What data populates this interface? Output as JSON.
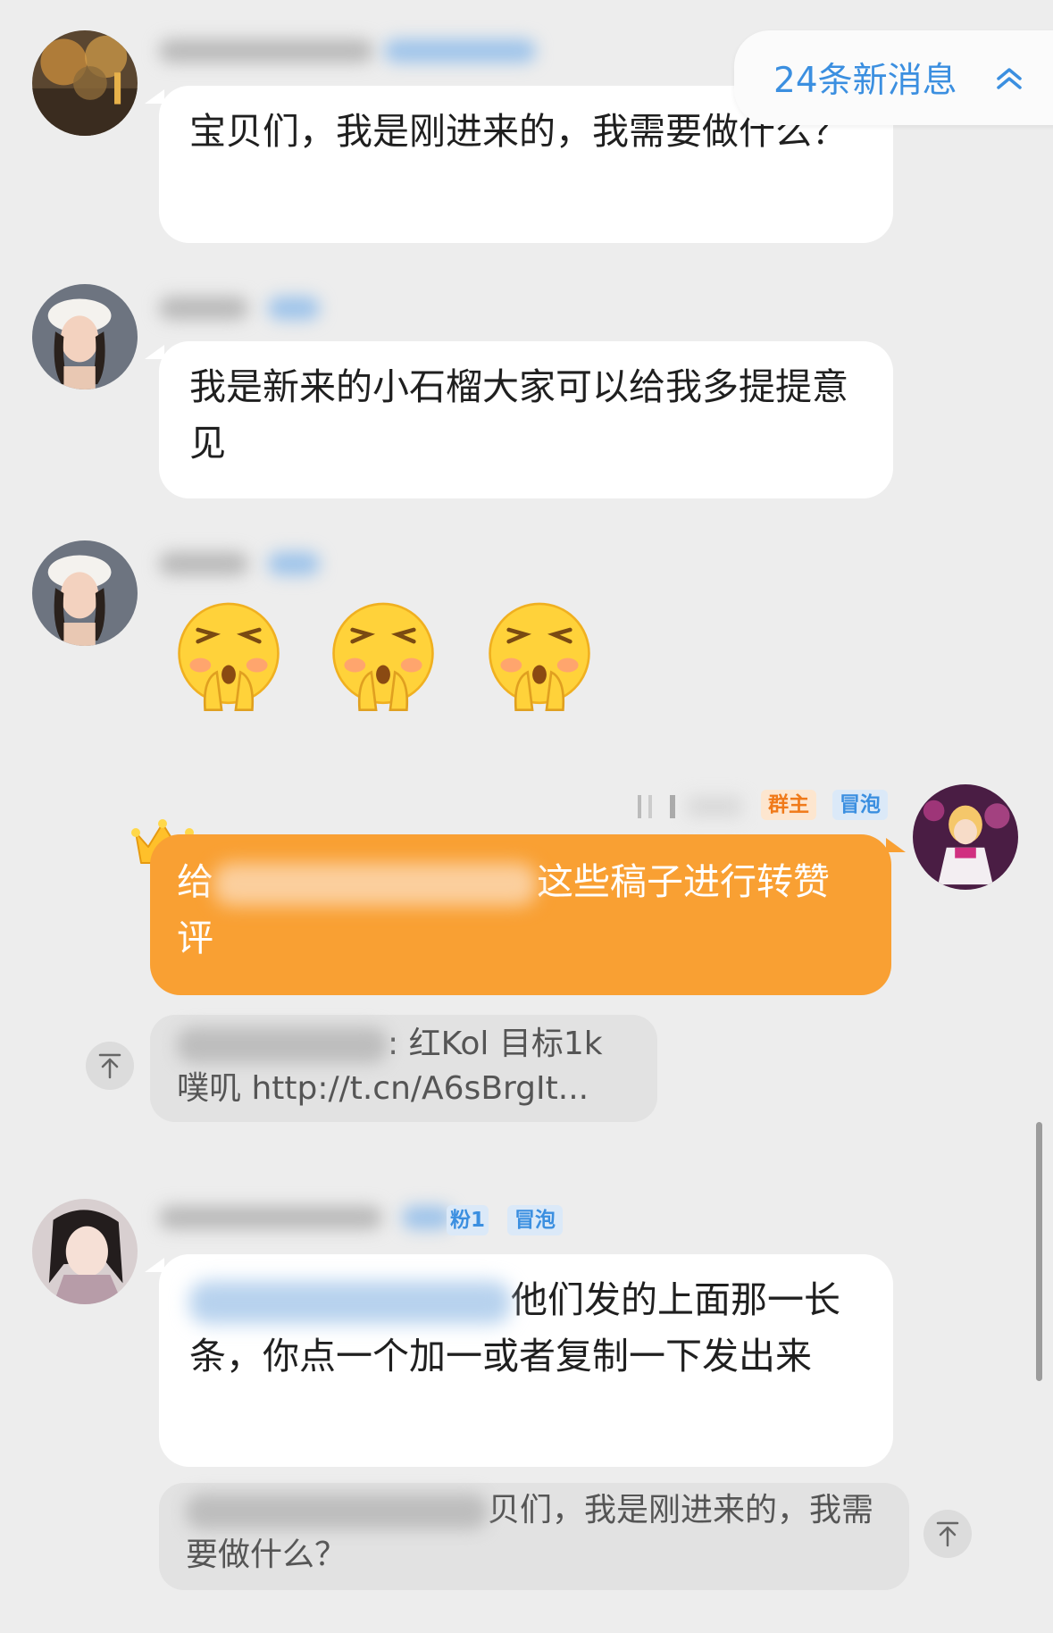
{
  "new_messages": {
    "label": "24条新消息"
  },
  "messages": [
    {
      "type": "text",
      "text": "宝贝们，我是刚进来的，我需要做什么？"
    },
    {
      "type": "text",
      "text": "我是新来的小石榴大家可以给我多提提意见"
    },
    {
      "type": "stickers",
      "count": 3,
      "sticker_name": "shy-praying-face"
    },
    {
      "type": "text",
      "sent_by_self": true,
      "tags": [
        "群主",
        "冒泡"
      ],
      "text_start": "给",
      "text_end": "这些稿子进行转赞评",
      "quote_line1": ": 红Kol  目标1k",
      "quote_line2": "噗叽 http://t.cn/A6sBrgIt..."
    },
    {
      "type": "text",
      "tags": [
        "粉1",
        "冒泡"
      ],
      "text": "他们发的上面那一长条，你点一个加一或者复制一下发出来",
      "quote_line1": "贝们，我是刚进来的，我需",
      "quote_line2": "要做什么？"
    }
  ],
  "colors": {
    "background": "#ededed",
    "own_bubble": "#f9a033",
    "link_blue": "#3b8fe0",
    "owner_tag": "#f07a1a",
    "bubble_tag": "#3b8fe0"
  }
}
